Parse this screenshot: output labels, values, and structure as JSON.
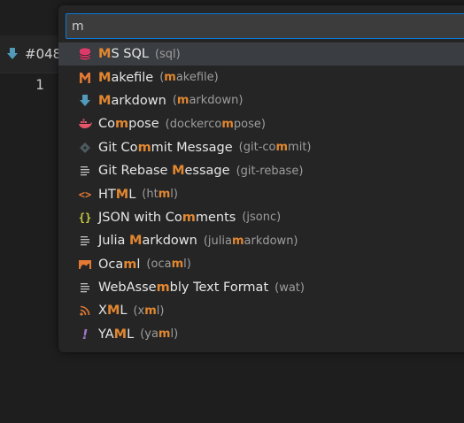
{
  "editor": {
    "tab_label": "#048",
    "line_number": "1"
  },
  "quick_pick": {
    "input_value": "m",
    "items": [
      {
        "name_parts": [
          "",
          "M",
          "S SQL"
        ],
        "desc_parts": [
          "(sql)"
        ],
        "icon": "database-icon",
        "icon_color": "#e03a6b",
        "selected": true
      },
      {
        "name_parts": [
          "",
          "M",
          "akefile"
        ],
        "desc_parts": [
          "(",
          "m",
          "akefile)"
        ],
        "icon": "makefile-icon",
        "icon_color": "#e37933"
      },
      {
        "name_parts": [
          "",
          "M",
          "arkdown"
        ],
        "desc_parts": [
          "(",
          "m",
          "arkdown)"
        ],
        "icon": "markdown-arrow-icon",
        "icon_color": "#519aba"
      },
      {
        "name_parts": [
          "Co",
          "m",
          "pose"
        ],
        "desc_parts": [
          "(dockerco",
          "m",
          "pose)"
        ],
        "icon": "docker-icon",
        "icon_color": "#e8556a"
      },
      {
        "name_parts": [
          "Git Co",
          "m",
          "mit Message"
        ],
        "desc_parts": [
          "(git-co",
          "m",
          "mit)"
        ],
        "icon": "git-diamond-icon",
        "icon_color": "#4d5a5e"
      },
      {
        "name_parts": [
          "Git Rebase ",
          "M",
          "essage"
        ],
        "desc_parts": [
          "(git-rebase)"
        ],
        "icon": "lines-icon",
        "icon_color": "#c0c0c0"
      },
      {
        "name_parts": [
          "HT",
          "M",
          "L"
        ],
        "desc_parts": [
          "(ht",
          "m",
          "l)"
        ],
        "icon": "html-brackets-icon",
        "icon_color": "#e37933"
      },
      {
        "name_parts": [
          "JSON with Co",
          "m",
          "ments"
        ],
        "desc_parts": [
          "(jsonc)"
        ],
        "icon": "json-braces-icon",
        "icon_color": "#cbcb41"
      },
      {
        "name_parts": [
          "Julia ",
          "M",
          "arkdown"
        ],
        "desc_parts": [
          "(julia",
          "m",
          "arkdown)"
        ],
        "icon": "lines-icon",
        "icon_color": "#c0c0c0"
      },
      {
        "name_parts": [
          "Oca",
          "m",
          "l"
        ],
        "desc_parts": [
          "(oca",
          "m",
          "l)"
        ],
        "icon": "ocaml-camel-icon",
        "icon_color": "#e37933"
      },
      {
        "name_parts": [
          "WebAsse",
          "m",
          "bly Text Format"
        ],
        "desc_parts": [
          "(wat)"
        ],
        "icon": "lines-icon",
        "icon_color": "#c0c0c0"
      },
      {
        "name_parts": [
          "X",
          "M",
          "L"
        ],
        "desc_parts": [
          "(x",
          "m",
          "l)"
        ],
        "icon": "rss-icon",
        "icon_color": "#e37933"
      },
      {
        "name_parts": [
          "YA",
          "M",
          "L"
        ],
        "desc_parts": [
          "(ya",
          "m",
          "l)"
        ],
        "icon": "exclamation-icon",
        "icon_color": "#a074c4"
      }
    ]
  }
}
